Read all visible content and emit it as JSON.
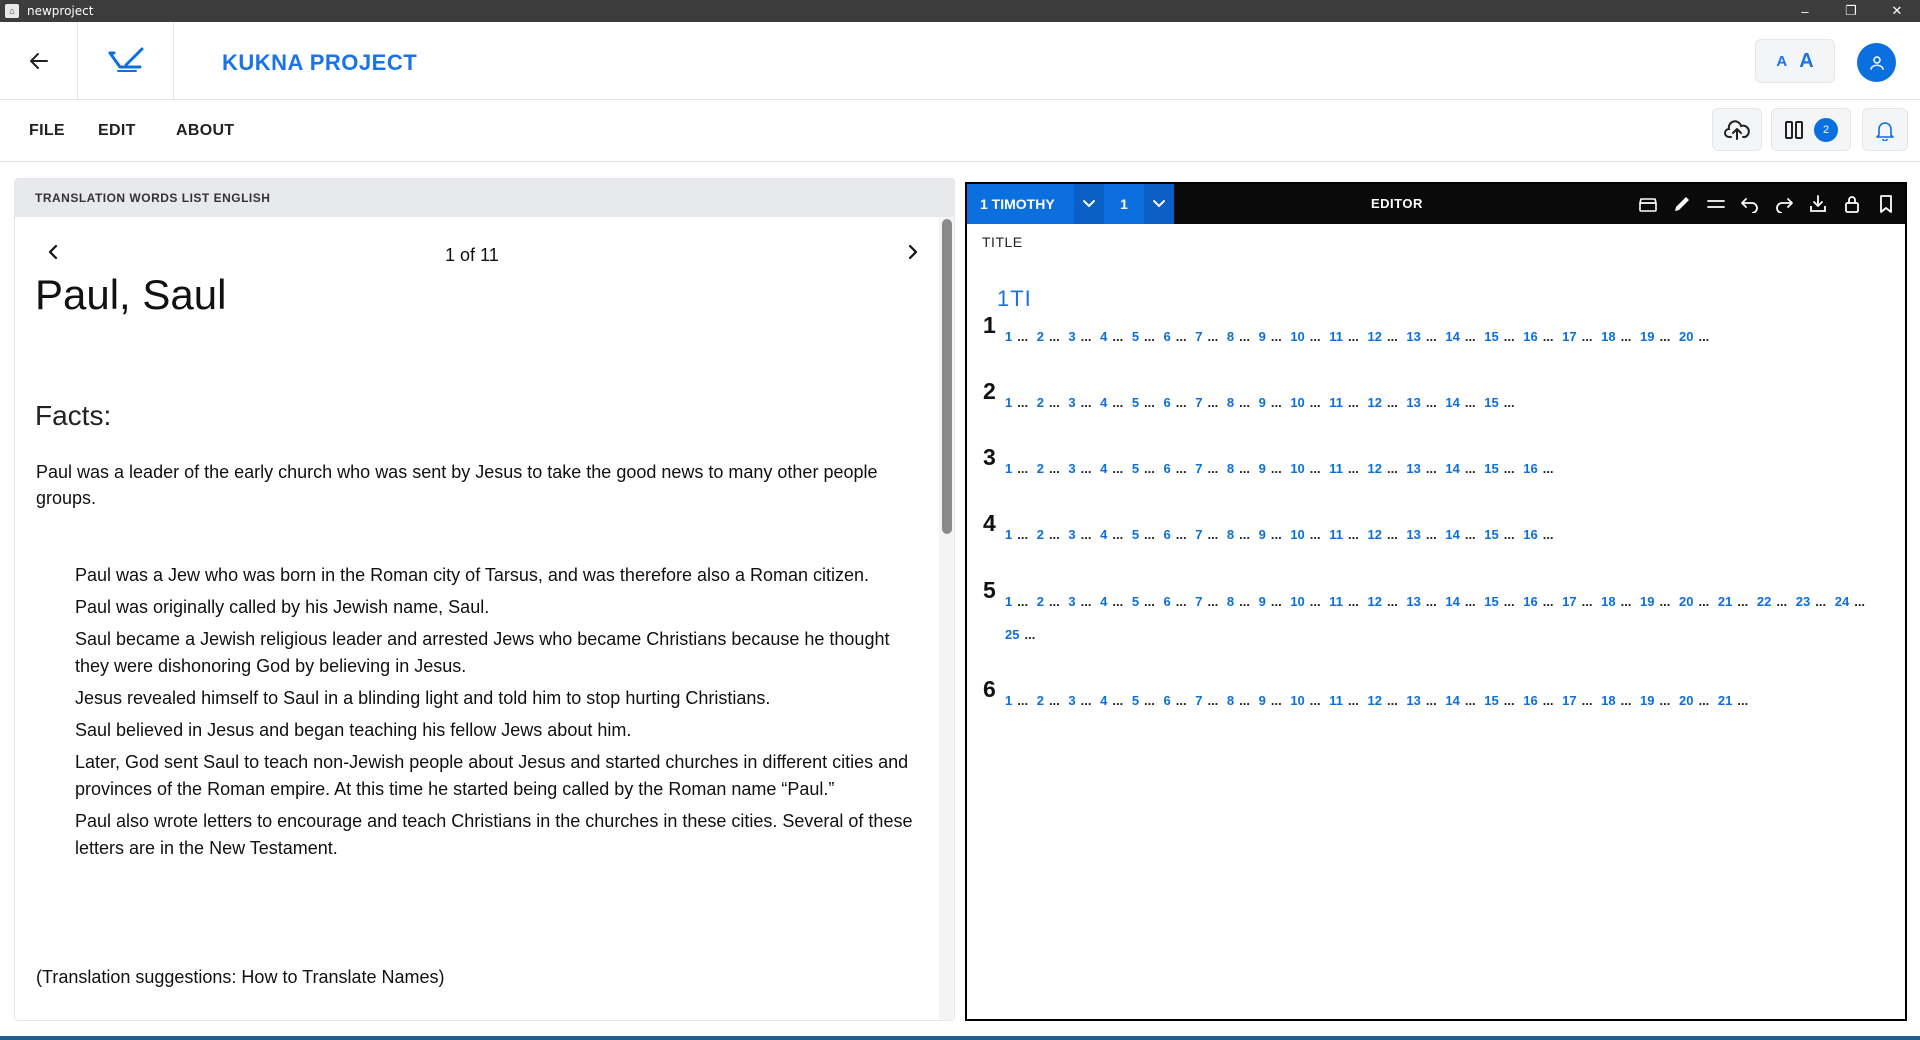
{
  "window": {
    "title": "newproject",
    "app_icon": "app-icon",
    "controls": {
      "minimize": "–",
      "restore": "❐",
      "close": "✕"
    }
  },
  "header": {
    "project_title": "KUKNA PROJECT",
    "font_size_small": "A",
    "font_size_large": "A"
  },
  "menu": {
    "file": "FILE",
    "edit": "EDIT",
    "about": "ABOUT",
    "notification_badge": "2"
  },
  "left_panel": {
    "header": "TRANSLATION WORDS LIST ENGLISH",
    "counter": "1 of 11",
    "title": "Paul, Saul",
    "section_heading": "Facts:",
    "intro": "Paul was a leader of the early church who was sent by Jesus to take the good news to many other people groups.",
    "facts": [
      "Paul was a Jew who was born in the Roman city of Tarsus, and was therefore also a Roman citizen.",
      "Paul was originally called by his Jewish name, Saul.",
      "Saul became a Jewish religious leader and arrested Jews who became Christians because he thought they were dishonoring God by believing in Jesus.",
      "Jesus revealed himself to Saul in a blinding light and told him to stop hurting Christians.",
      "Saul believed in Jesus and began teaching his fellow Jews about him.",
      "Later, God sent Saul to teach non-Jewish people about Jesus and started churches in different cities and provinces of the Roman empire. At this time he started being called by the Roman name “Paul.”",
      "Paul also wrote letters to encourage and teach Christians in the churches in these cities. Several of these letters are in the New Testament."
    ],
    "suggestions": "(Translation suggestions: How to Translate Names)"
  },
  "editor": {
    "book": "1 TIMOTHY",
    "chapter": "1",
    "label": "EDITOR",
    "title_label": "TITLE",
    "book_code": "1TI",
    "chapters": [
      {
        "number": "1",
        "verse_count": 20
      },
      {
        "number": "2",
        "verse_count": 15
      },
      {
        "number": "3",
        "verse_count": 16
      },
      {
        "number": "4",
        "verse_count": 16
      },
      {
        "number": "5",
        "verse_count": 25
      },
      {
        "number": "6",
        "verse_count": 21
      }
    ],
    "separator": "..."
  },
  "colors": {
    "accent": "#0b6fe0",
    "link": "#1a73e8",
    "editor_bar": "#0a0a0a"
  }
}
